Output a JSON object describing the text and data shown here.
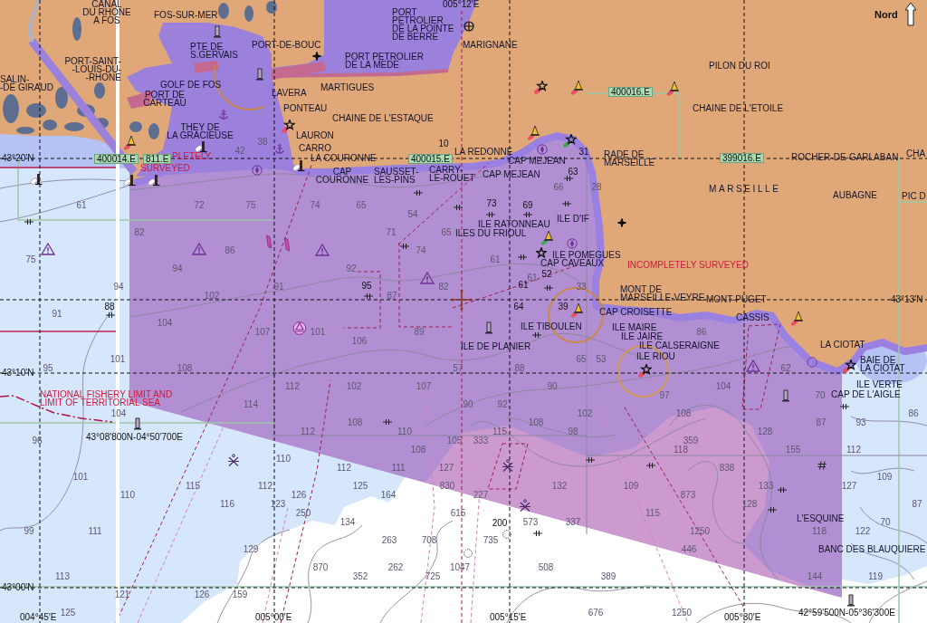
{
  "chart": {
    "north_indicator": {
      "label": "Nord"
    },
    "latitude_labels": [
      "43°20'N",
      "43°13'N",
      "43°10'N",
      "43°00'N"
    ],
    "longitude_labels": [
      "005°12'E",
      "004°45'E",
      "005°00'E",
      "005°15'E",
      "005°30'E"
    ],
    "place_names": [
      {
        "lines": [
          "CANAL",
          "DU RHONE",
          "A FOS"
        ]
      },
      {
        "lines": [
          "FOS-SUR-MER"
        ]
      },
      {
        "lines": [
          "PORT",
          "PETROLIER",
          "DE LA POINTE",
          "DE BERRE"
        ]
      },
      {
        "lines": [
          "PTE DE",
          "S.GERVAIS"
        ]
      },
      {
        "lines": [
          "PORT-DE-BOUC"
        ]
      },
      {
        "lines": [
          "MARIGNANE"
        ]
      },
      {
        "lines": [
          "PORT-SAINT-",
          "-LOUIS-DU-",
          "-RHONE"
        ]
      },
      {
        "lines": [
          "PORT PETROLIER",
          "DE LA MEDE"
        ]
      },
      {
        "lines": [
          "PILON DU ROI"
        ]
      },
      {
        "lines": [
          "SALIN-",
          "-DE GIRAUD"
        ]
      },
      {
        "lines": [
          "GOLF DE FOS"
        ]
      },
      {
        "lines": [
          "PORT DE",
          "CARTEAU"
        ]
      },
      {
        "lines": [
          "LAVERA"
        ]
      },
      {
        "lines": [
          "MARTIGUES"
        ]
      },
      {
        "lines": [
          "PONTEAU"
        ]
      },
      {
        "lines": [
          "CHAINE DE L'ETOILE"
        ]
      },
      {
        "lines": [
          "CHAINE DE L'ESTAQUE"
        ]
      },
      {
        "lines": [
          "THEY DE",
          "LA GRACIEUSE"
        ]
      },
      {
        "lines": [
          "LAURON"
        ]
      },
      {
        "lines": [
          "CARRO"
        ]
      },
      {
        "lines": [
          "LA COURONNE"
        ]
      },
      {
        "lines": [
          "LA REDONNE"
        ]
      },
      {
        "lines": [
          "CAP MEJEAN"
        ]
      },
      {
        "lines": [
          "RADE DE",
          "MARSEILLE"
        ]
      },
      {
        "lines": [
          "ROCHER-DE-GARLABAN"
        ]
      },
      {
        "lines": [
          "CHA"
        ]
      },
      {
        "lines": [
          "CAP",
          "COURONNE"
        ]
      },
      {
        "lines": [
          "SAUSSET-",
          "LES-PINS"
        ]
      },
      {
        "lines": [
          "CARRY-",
          "LE-ROUET"
        ]
      },
      {
        "lines": [
          "CAP MEJEAN"
        ]
      },
      {
        "lines": [
          "MARSEILLE"
        ]
      },
      {
        "lines": [
          "AUBAGNE"
        ]
      },
      {
        "lines": [
          "PIC D"
        ]
      },
      {
        "lines": [
          "ILE RATONNEAU"
        ]
      },
      {
        "lines": [
          "ILE D'IF"
        ]
      },
      {
        "lines": [
          "ILES DU FRIOUL"
        ]
      },
      {
        "lines": [
          "ILE POMEGUES"
        ]
      },
      {
        "lines": [
          "CAP CAVEAUX"
        ]
      },
      {
        "lines": [
          "MONT DE",
          "MARSEILLE-VEYRE"
        ]
      },
      {
        "lines": [
          "MONT-PUGET"
        ]
      },
      {
        "lines": [
          "CAP CROISETTE"
        ]
      },
      {
        "lines": [
          "CASSIS"
        ]
      },
      {
        "lines": [
          "ILE TIBOULEN"
        ]
      },
      {
        "lines": [
          "ILE MAIRE"
        ]
      },
      {
        "lines": [
          "ILE JAIRE"
        ]
      },
      {
        "lines": [
          "ILE DE PLANIER"
        ]
      },
      {
        "lines": [
          "ILE CALSERAIGNE"
        ]
      },
      {
        "lines": [
          "LA CIOTAT"
        ]
      },
      {
        "lines": [
          "ILE RIOU"
        ]
      },
      {
        "lines": [
          "BAIE DE",
          "LA CIOTAT"
        ]
      },
      {
        "lines": [
          "ILE VERTE"
        ]
      },
      {
        "lines": [
          "CAP DE L'AIGLE"
        ]
      },
      {
        "lines": [
          "L'ESQUINE"
        ]
      },
      {
        "lines": [
          "BANC DES BLAUQUIERE"
        ]
      }
    ],
    "notes": [
      {
        "lines": [
          "PLETELY"
        ]
      },
      {
        "lines": [
          "SURVEYED"
        ]
      },
      {
        "lines": [
          "INCOMPLETELY SURVEYED"
        ]
      },
      {
        "lines": [
          "NATIONAL FISHERY LIMIT AND",
          "LIMIT OF TERRITORIAL SEA"
        ]
      }
    ],
    "cell_tags": [
      "400016.E",
      "400014.E",
      "811.E",
      "400015.E",
      "399016.E"
    ],
    "position_labels": [
      "43°08'800N-04°50'700E",
      "42°59'500N-05°36'300E"
    ],
    "soundings": [
      "38",
      "42",
      "66",
      "28",
      "61",
      "72",
      "75",
      "74",
      "65",
      "54",
      "82",
      "71",
      "65",
      "86",
      "74",
      "75",
      "61",
      "94",
      "92",
      "61",
      "94",
      "91",
      "82",
      "33",
      "102",
      "87",
      "91",
      "104",
      "107",
      "101",
      "89",
      "86",
      "106",
      "101",
      "65",
      "53",
      "95",
      "108",
      "57",
      "88",
      "62",
      "112",
      "102",
      "107",
      "90",
      "104",
      "97",
      "70",
      "114",
      "90",
      "92",
      "104",
      "102",
      "108",
      "86",
      "108",
      "108",
      "87",
      "93",
      "112",
      "110",
      "115",
      "98",
      "128",
      "96",
      "105",
      "333",
      "359",
      "108",
      "118",
      "155",
      "112",
      "110",
      "112",
      "111",
      "127",
      "838",
      "101",
      "109",
      "115",
      "112",
      "125",
      "830",
      "132",
      "109",
      "133",
      "127",
      "110",
      "126",
      "164",
      "227",
      "873",
      "116",
      "123",
      "128",
      "87",
      "250",
      "615",
      "115",
      "134",
      "573",
      "337",
      "70",
      "99",
      "111",
      "1250",
      "118",
      "122",
      "263",
      "708",
      "735",
      "129",
      "446",
      "870",
      "262",
      "1047",
      "508",
      "113",
      "352",
      "725",
      "389",
      "144",
      "119",
      "121",
      "126",
      "159",
      "125",
      "676",
      "1250"
    ],
    "spot_depths": [
      "10",
      "31",
      "63",
      "73",
      "69",
      "52",
      "95",
      "61",
      "88",
      "64",
      "39",
      "200"
    ]
  }
}
